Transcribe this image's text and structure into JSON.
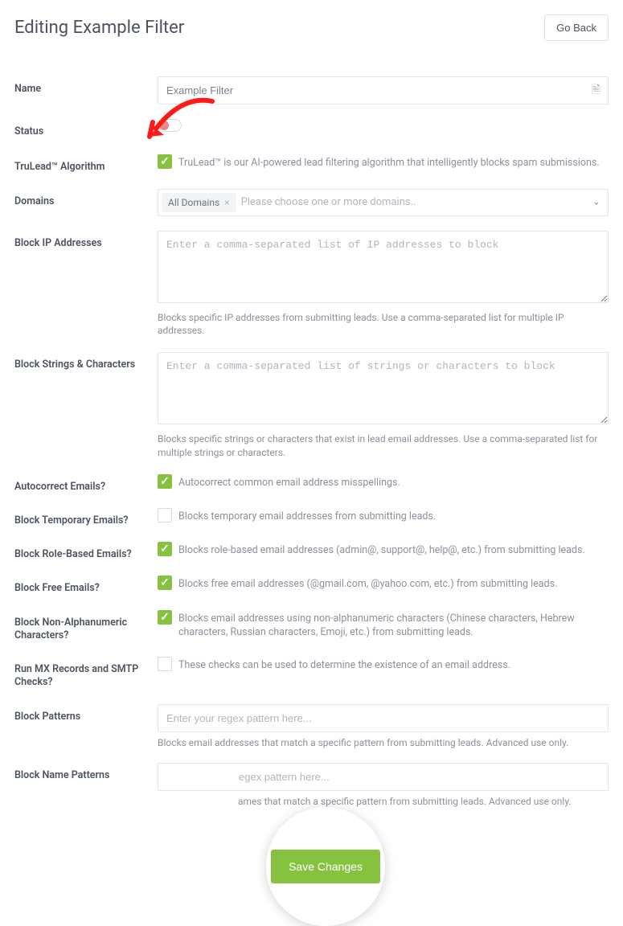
{
  "header": {
    "title": "Editing Example Filter",
    "go_back": "Go Back"
  },
  "fields": {
    "name": {
      "label": "Name",
      "value": "Example Filter"
    },
    "status": {
      "label": "Status"
    },
    "trulead": {
      "label": "TruLead™ Algorithm",
      "desc": "TruLead™ is our AI-powered lead filtering algorithm that intelligently blocks spam submissions."
    },
    "domains": {
      "label": "Domains",
      "chip": "All Domains",
      "placeholder": "Please choose one or more domains.."
    },
    "blockip": {
      "label": "Block IP Addresses",
      "placeholder": "Enter a comma-separated list of IP addresses to block",
      "help": "Blocks specific IP addresses from submitting leads. Use a comma-separated list for multiple IP addresses."
    },
    "blockstrings": {
      "label": "Block Strings & Characters",
      "placeholder": "Enter a comma-separated list of strings or characters to block",
      "help": "Blocks specific strings or characters that exist in lead email addresses. Use a comma-separated list for multiple strings or characters."
    },
    "autocorrect": {
      "label": "Autocorrect Emails?",
      "desc": "Autocorrect common email address misspellings."
    },
    "blocktemp": {
      "label": "Block Temporary Emails?",
      "desc": "Blocks temporary email addresses from submitting leads."
    },
    "blockrole": {
      "label": "Block Role-Based Emails?",
      "desc": "Blocks role-based email addresses (admin@, support@, help@, etc.) from submitting leads."
    },
    "blockfree": {
      "label": "Block Free Emails?",
      "desc": "Blocks free email addresses (@gmail.com, @yahoo.com, etc.) from submitting leads."
    },
    "blocknonalpha": {
      "label": "Block Non-Alphanumeric Characters?",
      "desc": "Blocks email addresses using non-alphanumeric characters (Chinese characters, Hebrew characters, Russian characters, Emoji, etc.) from submitting leads."
    },
    "mxrecords": {
      "label": "Run MX Records and SMTP Checks?",
      "desc": "These checks can be used to determine the existence of an email address."
    },
    "blockpatterns": {
      "label": "Block Patterns",
      "placeholder": "Enter your regex pattern here...",
      "help": "Blocks email addresses that match a specific pattern from submitting leads. Advanced use only."
    },
    "blocknamepatterns": {
      "label": "Block Name Patterns",
      "placeholder_visible": "egex pattern here...",
      "help_visible": "ames that match a specific pattern from submitting leads. Advanced use only."
    }
  },
  "actions": {
    "save": "Save Changes"
  }
}
